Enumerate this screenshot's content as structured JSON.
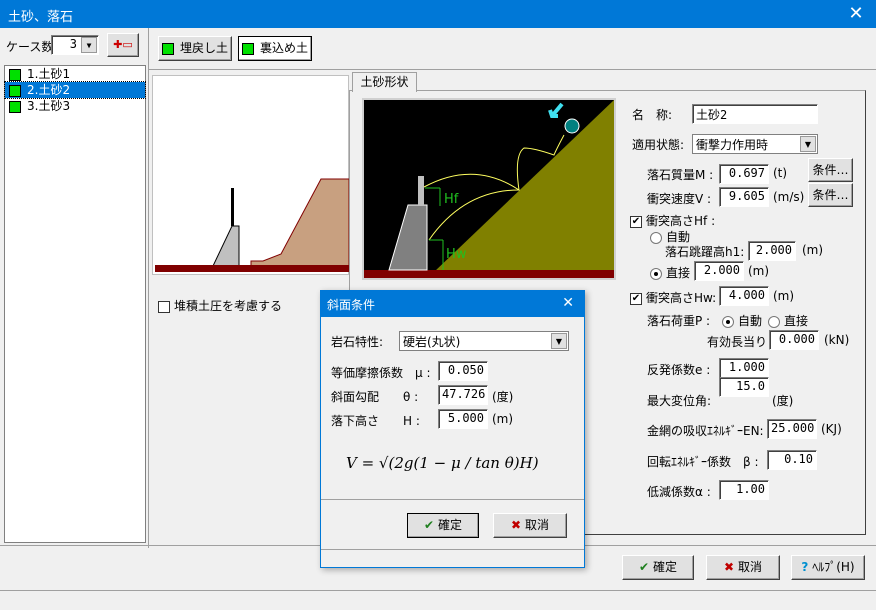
{
  "window": {
    "title": "土砂、落石",
    "close": "✕"
  },
  "left": {
    "case_label": "ケース数:",
    "case_count": "3",
    "cases": [
      {
        "label": "1.土砂1"
      },
      {
        "label": "2.土砂2"
      },
      {
        "label": "3.土砂3"
      }
    ],
    "selected_index": 1
  },
  "top_buttons": {
    "backfill": "埋戻し土",
    "back_fill": "裏込め土"
  },
  "tab": {
    "label": "土砂形状"
  },
  "diagram": {
    "hf_label": "Hf",
    "hw_label": "Hw"
  },
  "checkbox_deposit": {
    "label": "堆積土圧を考慮する",
    "checked": false
  },
  "form": {
    "name_label": "名　称:",
    "name_value": "土砂2",
    "state_label": "適用状態:",
    "state_value": "衝撃力作用時",
    "mass_label": "落石質量M :",
    "mass_value": "0.697",
    "mass_unit": "(t)",
    "mass_cond": "条件…",
    "speed_label": "衝突速度V :",
    "speed_value": "9.605",
    "speed_unit": "(m/s)",
    "speed_cond": "条件…",
    "hf_label": "衝突高さHf :",
    "hf_checked": true,
    "auto_label": "自動",
    "h1_label": "落石跳躍高h1:",
    "h1_value": "2.000",
    "h1_unit": "(m)",
    "direct_label": "直接",
    "direct_value": "2.000",
    "direct_unit": "(m)",
    "hw_label": "衝突高さHw:",
    "hw_value": "4.000",
    "hw_unit": "(m)",
    "hw_checked": true,
    "load_label": "落石荷重P :",
    "load_auto": "自動",
    "load_direct": "直接",
    "eff_label": "有効長当り",
    "eff_value": "0.000",
    "eff_unit": "(kN)",
    "e_label": "反発係数e :",
    "e_value": "1.000",
    "angle_label": "最大変位角:",
    "angle_value": "15.0",
    "angle_unit": "(度)",
    "en_label": "金網の吸収ｴﾈﾙｷﾞｰEN:",
    "en_value": "25.000",
    "en_unit": "(KJ)",
    "beta_label": "回転ｴﾈﾙｷﾞｰ係数　β :",
    "beta_value": "0.10",
    "alpha_label": "低減係数α :",
    "alpha_value": "1.00"
  },
  "dialog": {
    "title": "斜面条件",
    "close": "✕",
    "rock_label": "岩石特性:",
    "rock_value": "硬岩(丸状)",
    "mu_label": "等価摩擦係数　μ :",
    "mu_value": "0.050",
    "theta_label": "斜面勾配　　θ :",
    "theta_value": "47.726",
    "theta_unit": "(度)",
    "h_label": "落下高さ　　H :",
    "h_value": "5.000",
    "h_unit": "(m)",
    "formula": "V = √(2g(1 − μ / tan θ)H)",
    "ok": "確定",
    "cancel": "取消"
  },
  "bottom": {
    "ok": "確定",
    "cancel": "取消",
    "help": "ﾍﾙﾌﾟ(H)"
  },
  "colors": {
    "title": "#0078d7",
    "slope": "#808000",
    "ground": "#800000",
    "soil": "#c8a080"
  }
}
